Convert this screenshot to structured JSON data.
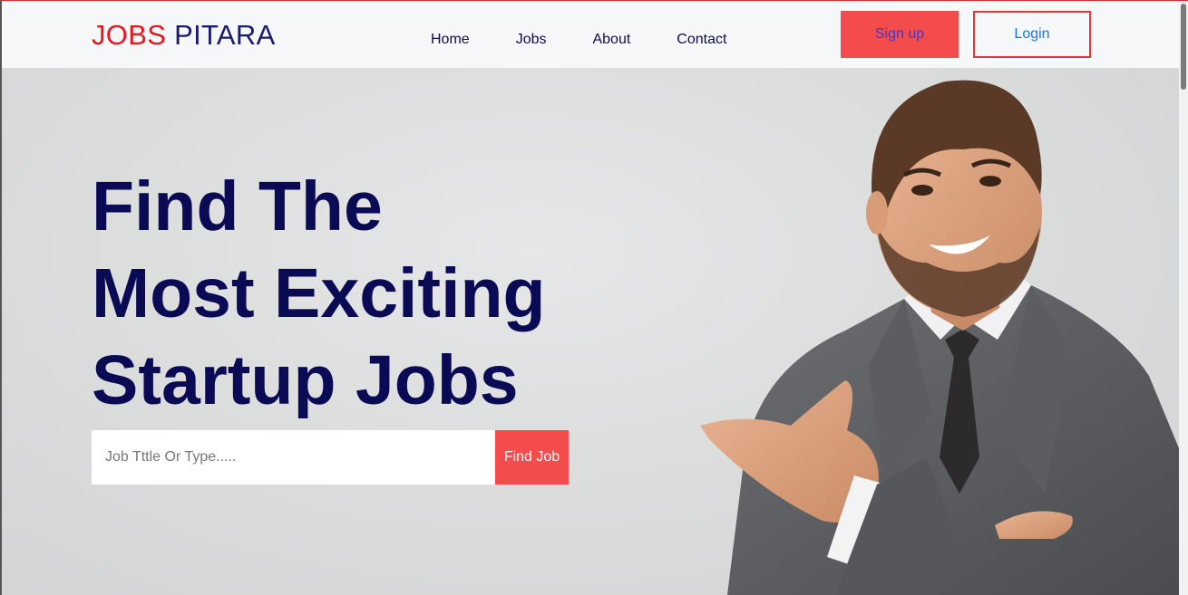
{
  "header": {
    "logo_part1": "JOBS",
    "logo_part2": "PITARA",
    "nav": [
      {
        "label": "Home"
      },
      {
        "label": "Jobs"
      },
      {
        "label": "About"
      },
      {
        "label": "Contact"
      }
    ],
    "signup_label": "Sign up",
    "login_label": "Login"
  },
  "hero": {
    "title_lines": [
      "Find The",
      "Most Exciting",
      "Startup Jobs"
    ],
    "search": {
      "placeholder": "Job Tttle Or Type.....",
      "value": "",
      "button_label": "Find Job"
    }
  },
  "colors": {
    "accent_red": "#f44c4c",
    "logo_red": "#e8151d",
    "navy": "#0b0b55",
    "login_text": "#1a73e8"
  }
}
